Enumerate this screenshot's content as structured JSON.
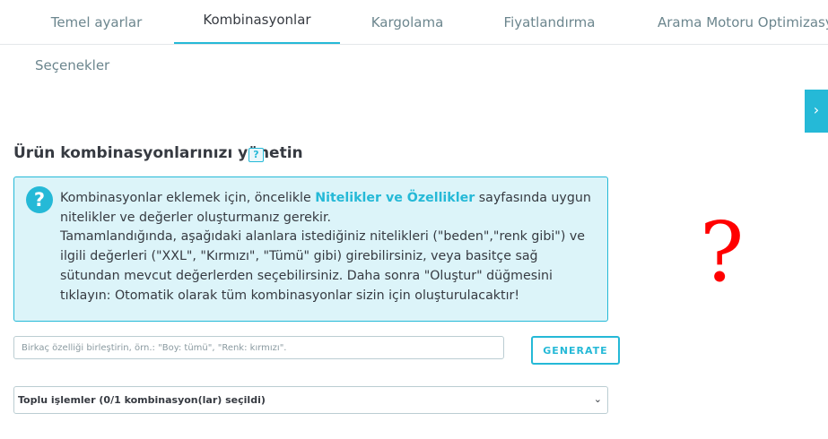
{
  "tabs": [
    {
      "label": "Temel ayarlar"
    },
    {
      "label": "Kombinasyonlar"
    },
    {
      "label": "Kargolama"
    },
    {
      "label": "Fiyatlandırma"
    },
    {
      "label": "Arama Motoru Optimizasyonu"
    }
  ],
  "active_tab": "Kombinasyonlar",
  "subtab": {
    "label": "Seçenekler"
  },
  "side_toggle": {
    "icon": "chevron-right-icon",
    "glyph": "›"
  },
  "section": {
    "title": "Ürün kombinasyonlarınızı yönetin",
    "help_glyph": "?"
  },
  "alert": {
    "icon_glyph": "?",
    "text_before_link": "Kombinasyonlar eklemek için, öncelikle ",
    "link": "Nitelikler ve Özellikler",
    "text_after_link": " sayfasında uygun nitelikler ve değerler oluşturmanız gerekir.",
    "text_second": "Tamamlandığında, aşağıdaki alanlara istediğiniz nitelikleri (\"beden\",\"renk gibi\") ve ilgili değerleri (\"XXL\", \"Kırmızı\", \"Tümü\" gibi) girebilirsiniz, veya basitçe sağ sütundan mevcut değerlerden seçebilirsiniz. Daha sonra \"Oluştur\" düğmesini tıklayın: Otomatik olarak tüm kombinasyonlar sizin için oluşturulacaktır!"
  },
  "placeholder_mark": "?",
  "generator": {
    "input_value": "",
    "input_placeholder": "Birkaç özelliği birleştirin, örn.: \"Boy: tümü\", \"Renk: kırmızı\".",
    "button_label": "GENERATE"
  },
  "bulk": {
    "selected_label": "Toplu işlemler (0/1 kombinasyon(lar) seçildi)",
    "caret_glyph": "⌄"
  },
  "colors": {
    "accent": "#25b9d7",
    "alert_bg": "#dcf4f9",
    "text": "#363a41",
    "muted": "#6c868e",
    "mark": "#ff0000"
  }
}
